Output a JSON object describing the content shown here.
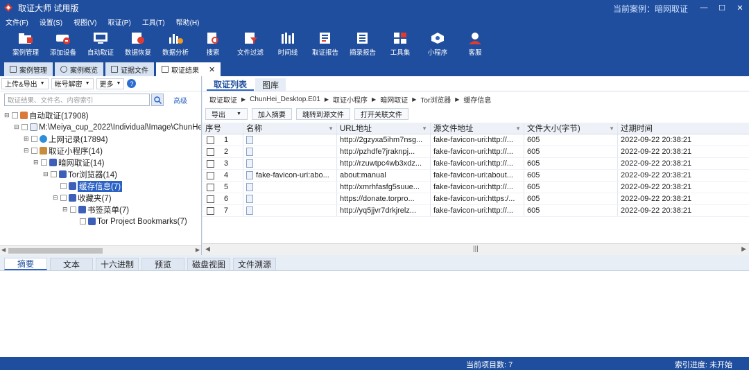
{
  "window": {
    "title": "取证大师 试用版",
    "case_label": "当前案例：暗网取证"
  },
  "menu": [
    "文件(F)",
    "设置(S)",
    "视图(V)",
    "取证(P)",
    "工具(T)",
    "帮助(H)"
  ],
  "toolbar": [
    "案例管理",
    "添加设备",
    "自动取证",
    "数据恢复",
    "数据分析",
    "搜索",
    "文件过滤",
    "时间线",
    "取证报告",
    "摘录报告",
    "工具集",
    "小程序",
    "客服"
  ],
  "doc_tabs": [
    "案例管理",
    "案例概览",
    "证据文件",
    "取证结果"
  ],
  "left": {
    "upload_export": "上传&导出",
    "account_decrypt": "帐号解密",
    "more": "更多",
    "help": "?",
    "search_placeholder": "取证结果、文件名、内容索引",
    "advanced": "高级",
    "tree": [
      {
        "label": "自动取证(17908)",
        "expander": "⊟"
      },
      {
        "label": "M:\\Meiya_cup_2022\\Individual\\Image\\ChunHei",
        "expander": "⊟"
      },
      {
        "label": "上网记录(17894)",
        "expander": "⊞"
      },
      {
        "label": "取证小程序(14)",
        "expander": "⊟"
      },
      {
        "label": "暗网取证(14)",
        "expander": "⊟"
      },
      {
        "label": "Tor浏览器(14)",
        "expander": "⊟"
      },
      {
        "label": "缓存信息(7)",
        "expander": ""
      },
      {
        "label": "收藏夹(7)",
        "expander": "⊟"
      },
      {
        "label": "书签菜单(7)",
        "expander": "⊟"
      },
      {
        "label": "Tor Project Bookmarks(7)",
        "expander": ""
      }
    ]
  },
  "right": {
    "tabs": [
      "取证列表",
      "图库"
    ],
    "breadcrumb": [
      "取证取证",
      "ChunHei_Desktop.E01",
      "取证小程序",
      "暗网取证",
      "Tor浏览器",
      "缓存信息"
    ],
    "actions": [
      "导出",
      "加入摘要",
      "跳转到源文件",
      "打开关联文件"
    ],
    "columns": [
      "序号",
      "名称",
      "URL地址",
      "源文件地址",
      "文件大小(字节)",
      "过期时间"
    ],
    "rows": [
      {
        "n": "1",
        "name": "",
        "url": "http://2gzyxa5ihm7nsg...",
        "src": "fake-favicon-uri:http://...",
        "size": "605",
        "expire": "2022-09-22 20:38:21"
      },
      {
        "n": "2",
        "name": "",
        "url": "http://pzhdfe7jraknpj...",
        "src": "fake-favicon-uri:http://...",
        "size": "605",
        "expire": "2022-09-22 20:38:21"
      },
      {
        "n": "3",
        "name": "",
        "url": "http://rzuwtpc4wb3xdz...",
        "src": "fake-favicon-uri:http://...",
        "size": "605",
        "expire": "2022-09-22 20:38:21"
      },
      {
        "n": "4",
        "name": "fake-favicon-uri:abo...",
        "url": "about:manual",
        "src": "fake-favicon-uri:about...",
        "size": "605",
        "expire": "2022-09-22 20:38:21"
      },
      {
        "n": "5",
        "name": "",
        "url": "http://xmrhfasfg5suue...",
        "src": "fake-favicon-uri:http://...",
        "size": "605",
        "expire": "2022-09-22 20:38:21"
      },
      {
        "n": "6",
        "name": "",
        "url": "https://donate.torpro...",
        "src": "fake-favicon-uri:https:/...",
        "size": "605",
        "expire": "2022-09-22 20:38:21"
      },
      {
        "n": "7",
        "name": "",
        "url": "http://yq5jjvr7drkjrelz...",
        "src": "fake-favicon-uri:http://...",
        "size": "605",
        "expire": "2022-09-22 20:38:21"
      }
    ],
    "scroll_mid": "|||"
  },
  "bottom_tabs": [
    "摘要",
    "文本",
    "十六进制",
    "预览",
    "磁盘视图",
    "文件溯源"
  ],
  "status": {
    "count": "当前项目数: 7",
    "index": "索引进度: 未开始"
  }
}
